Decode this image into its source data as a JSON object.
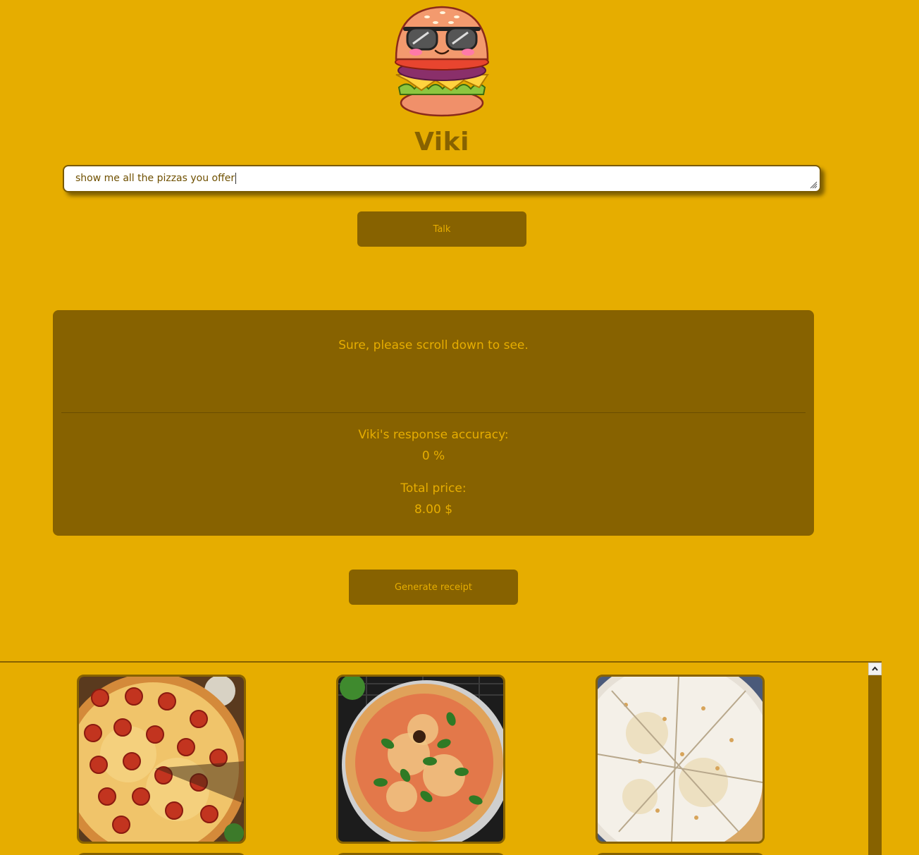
{
  "app": {
    "title": "Viki",
    "mascot_icon": "burger-mascot-icon"
  },
  "prompt": {
    "value": "show me all the pizzas you offer"
  },
  "actions": {
    "talk_label": "Talk",
    "receipt_label": "Generate receipt"
  },
  "response": {
    "message": "Sure, please scroll down to see.",
    "accuracy_label": "Viki's response accuracy:",
    "accuracy_value": "0 %",
    "price_label": "Total price:",
    "price_value": "8.00 $"
  },
  "gallery": {
    "items": [
      {
        "name": "pepperoni-pizza"
      },
      {
        "name": "margherita-pizza"
      },
      {
        "name": "white-cheese-pizza"
      }
    ]
  },
  "colors": {
    "background": "#e6ad00",
    "panel": "#876200",
    "accent_text": "#e6ad00",
    "title_text": "#876200"
  }
}
